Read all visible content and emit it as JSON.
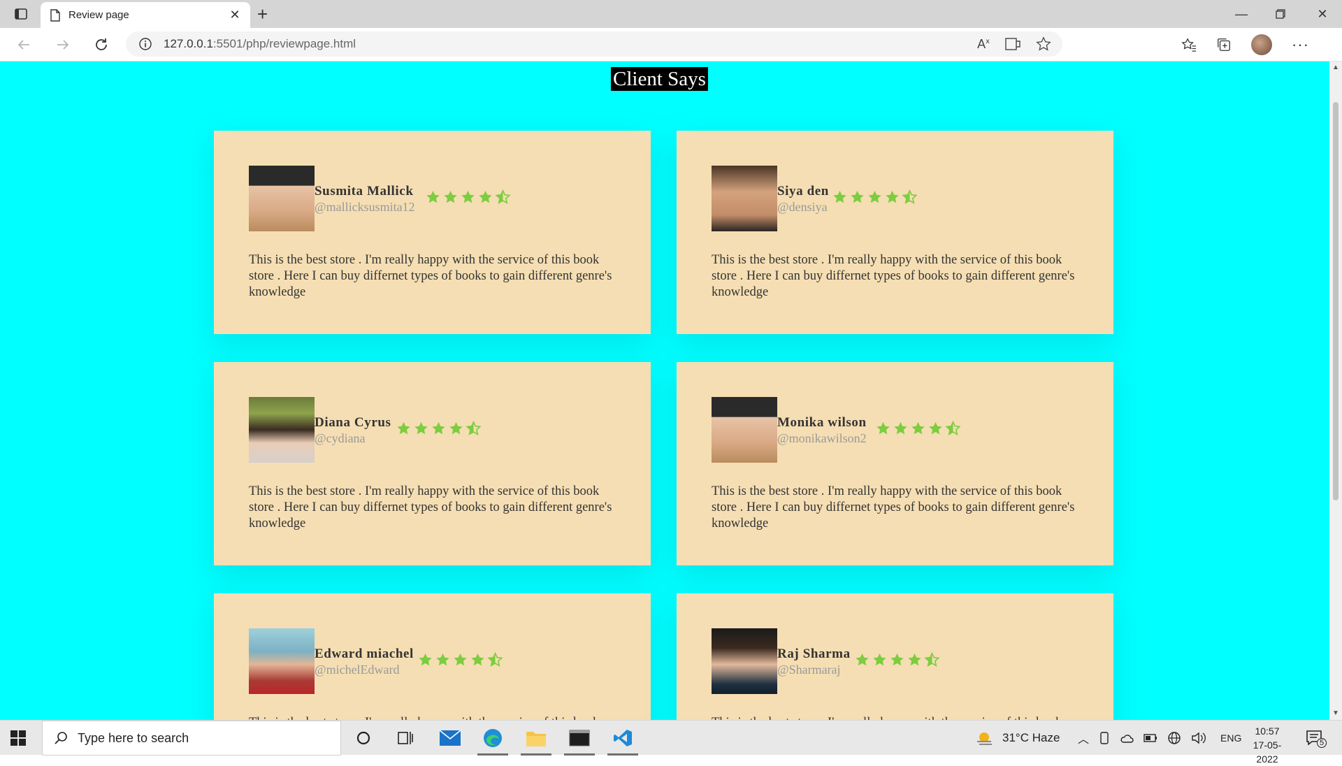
{
  "browser": {
    "tab_title": "Review page",
    "url_host": "127.0.0.1",
    "url_rest": ":5501/php/reviewpage.html"
  },
  "page": {
    "title": "Client Says",
    "background": "#00ffff",
    "card_background": "#f5deb3",
    "star_color": "#7ccd3f"
  },
  "reviews": [
    {
      "name": "Susmita Mallick",
      "handle": "@mallicksusmita12",
      "rating": 4.5,
      "text": "This is the best store . I'm really happy with the service of this book store . Here I can buy differnet types of books to gain different genre's knowledge"
    },
    {
      "name": "Siya den",
      "handle": "@densiya",
      "rating": 4.5,
      "text": "This is the best store . I'm really happy with the service of this book store . Here I can buy differnet types of books to gain different genre's knowledge"
    },
    {
      "name": "Diana Cyrus",
      "handle": "@cydiana",
      "rating": 4.5,
      "text": "This is the best store . I'm really happy with the service of this book store . Here I can buy differnet types of books to gain different genre's knowledge"
    },
    {
      "name": "Monika wilson",
      "handle": "@monikawilson2",
      "rating": 4.5,
      "text": "This is the best store . I'm really happy with the service of this book store . Here I can buy differnet types of books to gain different genre's knowledge"
    },
    {
      "name": "Edward miachel",
      "handle": "@michelEdward",
      "rating": 4.5,
      "text": "This is the best store . I'm really happy with the service of this book store . Here I can buy differnet types of books to gain different genre's knowledge"
    },
    {
      "name": "Raj Sharma",
      "handle": "@Sharmaraj",
      "rating": 4.5,
      "text": "This is the best store . I'm really happy with the service of this book store . Here I can buy differnet types of books to gain different genre's knowledge"
    }
  ],
  "taskbar": {
    "search_placeholder": "Type here to search",
    "weather": "31°C  Haze",
    "language": "ENG",
    "time": "10:57",
    "date": "17-05-2022",
    "notification_count": "5"
  }
}
